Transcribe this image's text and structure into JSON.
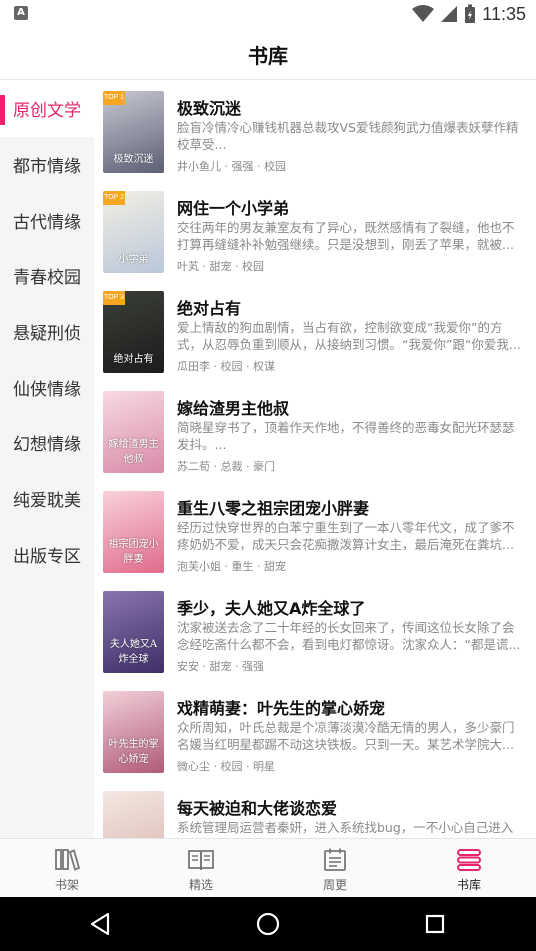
{
  "status_bar": {
    "time": "11:35",
    "left_icon": "A"
  },
  "header": {
    "title": "书库"
  },
  "sidebar": {
    "items": [
      {
        "label": "原创文学",
        "active": true
      },
      {
        "label": "都市情缘",
        "active": false
      },
      {
        "label": "古代情缘",
        "active": false
      },
      {
        "label": "青春校园",
        "active": false
      },
      {
        "label": "悬疑刑侦",
        "active": false
      },
      {
        "label": "仙侠情缘",
        "active": false
      },
      {
        "label": "幻想情缘",
        "active": false
      },
      {
        "label": "纯爱耽美",
        "active": false
      },
      {
        "label": "出版专区",
        "active": false
      }
    ]
  },
  "books": [
    {
      "title": "极致沉迷",
      "desc": "脸盲冷情冷心赚钱机器总裁攻VS爱钱颜狗武力值爆表妖孽作精校草受...",
      "tags": "井小鱼儿 · 强强 · 校园",
      "ribbon": "TOP 1",
      "cover_text": "极致沉迷",
      "cover_colors": [
        "#c9c9d4",
        "#5d5f73"
      ]
    },
    {
      "title": "网住一个小学弟",
      "desc": "交往两年的男友兼室友有了异心，既然感情有了裂缝，他也不打算再缝缝补补勉强继续。只是没想到，刚丢了苹果，就被...",
      "tags": "叶芄 · 甜宠 · 校园",
      "ribbon": "TOP 2",
      "cover_text": "小学弟",
      "cover_colors": [
        "#f3efe4",
        "#b9c7d9"
      ]
    },
    {
      "title": "绝对占有",
      "desc": "爱上情敌的狗血剧情，当占有欲，控制欲变成“我爱你”的方式，从忍辱负重到顺从，从接纳到习惯。“我爱你”跟“你爱我...",
      "tags": "瓜田李 · 校园 · 权谋",
      "ribbon": "TOP 3",
      "cover_text": "绝对占有",
      "cover_colors": [
        "#3b3f38",
        "#1c1c1c"
      ]
    },
    {
      "title": "嫁给渣男主他叔",
      "desc": "简晓星穿书了，顶着作天作地，不得善终的恶毒女配光环瑟瑟发抖。...",
      "tags": "苏二荀 · 总裁 · 豪门",
      "ribbon": "",
      "cover_text": "嫁给渣男主他叔",
      "cover_colors": [
        "#f7d9e3",
        "#d98aa8"
      ]
    },
    {
      "title": "重生八零之祖宗团宠小胖妻",
      "desc": "经历过快穿世界的白苯宁重生到了一本八零年代文，成了爹不疼奶奶不爱，成天只会花痴撒泼算计女主，最后淹死在粪坑...",
      "tags": "泡芙小姐 · 重生 · 甜宠",
      "ribbon": "",
      "cover_text": "祖宗团宠小胖妻",
      "cover_colors": [
        "#f9d2dc",
        "#e06b8c"
      ]
    },
    {
      "title": "季少，夫人她又A炸全球了",
      "desc": "沈家被送去念了二十年经的长女回来了，传闻这位长女除了会念经吃斋什么都不会，看到电灯都惊讶。沈家众人：“都是谎...",
      "tags": "安安 · 甜宠 · 强强",
      "ribbon": "",
      "cover_text": "夫人她又A炸全球",
      "cover_colors": [
        "#8b74b0",
        "#3e2f66"
      ]
    },
    {
      "title": "戏精萌妻：叶先生的掌心娇宠",
      "desc": "众所周知，叶氏总裁是个凉薄淡漠冷酷无情的男人，多少豪门名媛当红明星都踢不动这块铁板。只到一天。某艺术学院大...",
      "tags": "微心尘 · 校园 · 明星",
      "ribbon": "",
      "cover_text": "叶先生的掌心娇宠",
      "cover_colors": [
        "#f2d0d8",
        "#b05a7a"
      ]
    },
    {
      "title": "每天被迫和大佬谈恋爱",
      "desc": "系统管理局运营者秦妍，进入系统找bug，一不小心自己进入",
      "tags": "",
      "ribbon": "",
      "cover_text": "",
      "cover_colors": [
        "#f4e7e2",
        "#d9b8b0"
      ]
    }
  ],
  "tab_bar": {
    "tabs": [
      {
        "label": "书架",
        "icon": "bookshelf-icon",
        "active": false
      },
      {
        "label": "精选",
        "icon": "open-book-icon",
        "active": false
      },
      {
        "label": "周更",
        "icon": "calendar-icon",
        "active": false
      },
      {
        "label": "书库",
        "icon": "library-stack-icon",
        "active": true
      }
    ]
  },
  "colors": {
    "accent": "#e5246b",
    "tab_active": "#e5246b",
    "muted_text": "#8a8a8a"
  }
}
